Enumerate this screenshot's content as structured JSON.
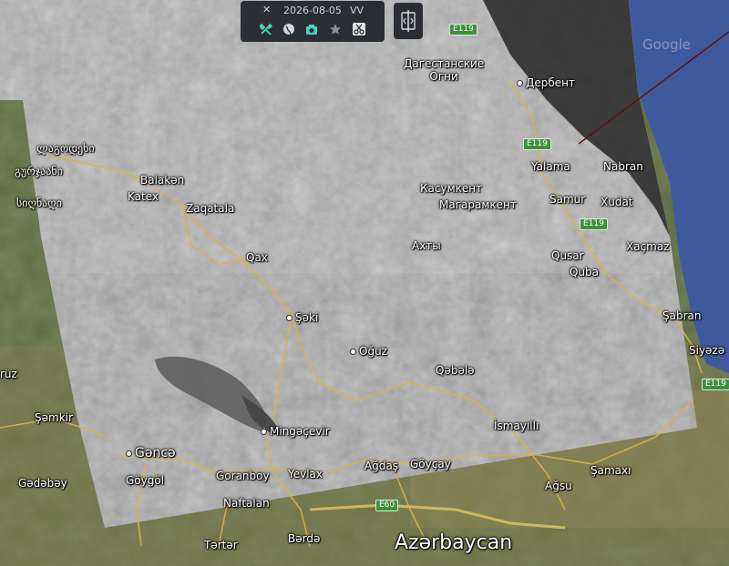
{
  "toolbar": {
    "close_glyph": "✕",
    "date": "2026-08-05",
    "mode": "VV",
    "buttons": [
      {
        "name": "tools-icon"
      },
      {
        "name": "globe-icon"
      },
      {
        "name": "camera-icon"
      },
      {
        "name": "star-icon"
      },
      {
        "name": "scissors-icon"
      }
    ]
  },
  "watermark": "Google",
  "labels": {
    "dagestanskie_ogni": "Дагестанские\nОгни",
    "derbent": "Дербент",
    "kasumkent": "Касумкент",
    "magaramkent": "Магарамкент",
    "akhty": "Ахты",
    "yalama": "Yalama",
    "nabran": "Nabran",
    "samur": "Samur",
    "xudat": "Xudat",
    "qusar": "Qusar",
    "xacmaz": "Xaçmaz",
    "quba": "Quba",
    "sabran": "Şabran",
    "siyezen": "Siyəzə",
    "lagodekhi": "ლაგოდეხი",
    "gurjaani": "გურჯაანი",
    "signagi": "სიღნაღი",
    "balaken": "Balakən",
    "katex": "Katex",
    "zaqatala": "Zaqatala",
    "qax": "Qax",
    "seki": "Şəki",
    "oguz": "Oğuz",
    "qebele": "Qəbələ",
    "ismayilli": "İsmayıllı",
    "mingecevir": "Mingəçevir",
    "ganca": "Gəncə",
    "goygol": "Göygöl",
    "goranboy": "Goranboy",
    "yevlax": "Yevlax",
    "agdas": "Ağdaş",
    "goycay": "Göyçay",
    "agsu": "Ağsu",
    "samaxi": "Şamaxı",
    "naftalan": "Naftalan",
    "terter": "Tərtər",
    "berde": "Bərdə",
    "azerbaycan": "Azərbaycan",
    "semkir": "Şəmkir",
    "gedebey": "Gədəbəy",
    "ruz": "ruz"
  },
  "shields": {
    "e119_a": "E119",
    "e119_b": "E119",
    "e119_c": "E119",
    "e119_d": "E119",
    "e60": "E60"
  }
}
